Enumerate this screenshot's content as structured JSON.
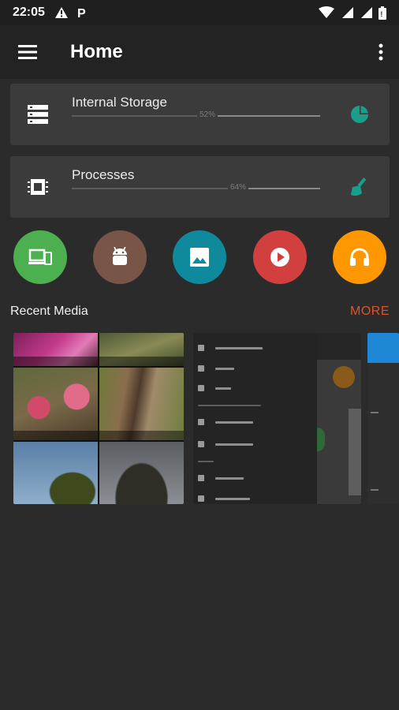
{
  "status_bar": {
    "time": "22:05",
    "left_icons": [
      "warning-icon",
      "parking-icon"
    ],
    "right_icons": [
      "wifi-icon",
      "signal-icon",
      "signal-icon",
      "battery-icon"
    ]
  },
  "app_bar": {
    "title": "Home",
    "menu_icon": "hamburger-menu-icon",
    "overflow_icon": "more-vert-icon"
  },
  "storage_card": {
    "title": "Internal Storage",
    "percent_label": "52%",
    "percent_value": 52,
    "icon": "storage-icon",
    "action_icon": "pie-chart-icon"
  },
  "processes_card": {
    "title": "Processes",
    "percent_label": "64%",
    "percent_value": 64,
    "icon": "memory-chip-icon",
    "action_icon": "broom-clean-icon"
  },
  "shortcuts": [
    {
      "name": "devices",
      "icon": "devices-icon",
      "color": "#4caf50"
    },
    {
      "name": "apps",
      "icon": "android-icon",
      "color": "#795548"
    },
    {
      "name": "images",
      "icon": "image-icon",
      "color": "#0e8a9c"
    },
    {
      "name": "videos",
      "icon": "play-icon",
      "color": "#d23f3f"
    },
    {
      "name": "audio",
      "icon": "headphones-icon",
      "color": "#ff9800"
    }
  ],
  "recent_media": {
    "label": "Recent Media",
    "more_label": "MORE"
  },
  "colors": {
    "background": "#2b2b2b",
    "card": "#3b3b3b",
    "accent_teal": "#1a9e8c",
    "more_orange": "#d9542c"
  }
}
